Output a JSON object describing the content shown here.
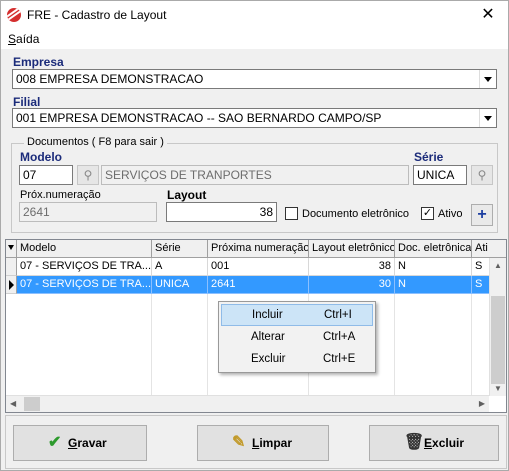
{
  "window": {
    "title": "FRE - Cadastro de Layout"
  },
  "menu": {
    "saida_prefix": "S",
    "saida_rest": "aída"
  },
  "empresa": {
    "label": "Empresa",
    "value": "008 EMPRESA DEMONSTRACAO"
  },
  "filial": {
    "label": "Filial",
    "value": "001 EMPRESA DEMONSTRACAO -- SAO BERNARDO CAMPO/SP"
  },
  "documentos": {
    "legend": "Documentos ( F8 para sair )",
    "modelo_label": "Modelo",
    "modelo_code": "07",
    "modelo_desc": "SERVIÇOS DE TRANPORTES",
    "serie_label": "Série",
    "serie_value": "UNICA",
    "prox_label": "Próx.numeração",
    "prox_value": "2641",
    "layout_label": "Layout",
    "layout_value": "38",
    "doc_eletronico_label": "Documento eletrônico",
    "doc_eletronico_checked": false,
    "ativo_label": "Ativo",
    "ativo_checked": true,
    "plus_label": "+"
  },
  "grid": {
    "columns": [
      "Modelo",
      "Série",
      "Próxima numeração",
      "Layout eletrônico",
      "Doc. eletrônica",
      "Ati"
    ],
    "rows": [
      {
        "modelo": "07 - SERVIÇOS DE TRA...",
        "serie": "A",
        "proxima": "001",
        "layout": "38",
        "doc": "N",
        "ativo": "S"
      },
      {
        "modelo": "07 - SERVIÇOS DE TRA...",
        "serie": "UNICA",
        "proxima": "2641",
        "layout": "30",
        "doc": "N",
        "ativo": "S"
      }
    ]
  },
  "context_menu": {
    "items": [
      {
        "label": "Incluir",
        "shortcut": "Ctrl+I"
      },
      {
        "label": "Alterar",
        "shortcut": "Ctrl+A"
      },
      {
        "label": "Excluir",
        "shortcut": "Ctrl+E"
      }
    ]
  },
  "buttons": {
    "gravar": {
      "underline": "G",
      "rest": "ravar"
    },
    "limpar": {
      "underline": "L",
      "rest": "impar"
    },
    "excluir": {
      "underline": "E",
      "rest": "xcluir"
    }
  },
  "colors": {
    "selection": "#3399ff",
    "label_blue": "#1b2b7a",
    "context_highlight": "#cce4f7"
  }
}
